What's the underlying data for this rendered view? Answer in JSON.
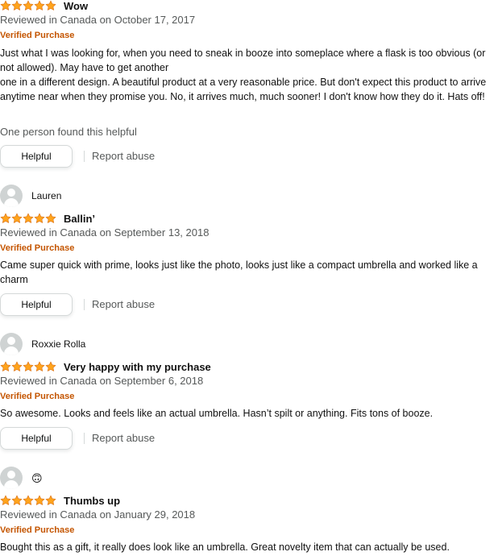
{
  "colors": {
    "star": "#ffa41c",
    "verified": "#c45500",
    "meta": "#565959",
    "avatar": "#cfd3d3"
  },
  "reviews": [
    {
      "rating": 5,
      "title": "Wow",
      "date": "Reviewed in Canada on October 17, 2017",
      "verified": "Verified Purchase",
      "body": [
        "Just what I was looking for, when you need to sneak in booze into someplace where a flask is too obvious (or not allowed). May have to get another",
        "one in a different design. A beautiful product at a very reasonable price. But don't expect this product to arrive anytime near when they promise you. No, it arrives much, much sooner! I don't know how they do it. Hats off!"
      ],
      "helpful_count": "One person found this helpful",
      "helpful_label": "Helpful",
      "report_label": "Report abuse"
    },
    {
      "reviewer": "Lauren",
      "rating": 5,
      "title": "Ballin’",
      "date": "Reviewed in Canada on September 13, 2018",
      "verified": "Verified Purchase",
      "body": [
        "Came super quick with prime, looks just like the photo, looks just like a compact umbrella and worked like a charm"
      ],
      "helpful_label": "Helpful",
      "report_label": "Report abuse"
    },
    {
      "reviewer": "Roxxie Rolla",
      "rating": 5,
      "title": "Very happy with my purchase",
      "date": "Reviewed in Canada on September 6, 2018",
      "verified": "Verified Purchase",
      "body": [
        "So awesome. Looks and feels like an actual umbrella. Hasn’t spilt or anything. Fits tons of booze."
      ],
      "helpful_label": "Helpful",
      "report_label": "Report abuse"
    },
    {
      "reviewer": "🙃",
      "rating": 5,
      "title": "Thumbs up",
      "date": "Reviewed in Canada on January 29, 2018",
      "verified": "Verified Purchase",
      "body": [
        "Bought this as a gift, it really does look like an umbrella. Great novelty item that can actually be used."
      ]
    }
  ]
}
